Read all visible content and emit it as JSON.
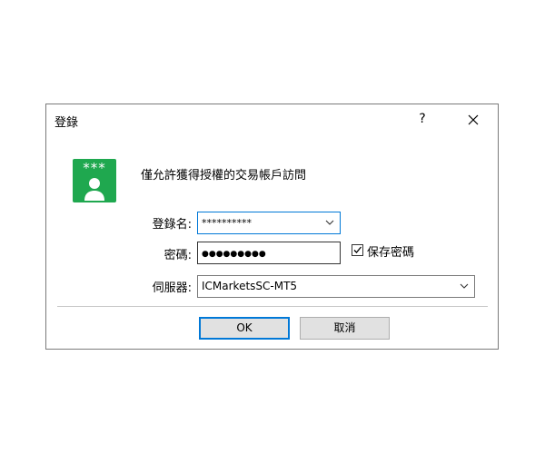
{
  "dialog": {
    "title": "登錄",
    "help_label": "?",
    "close_icon": "close-icon",
    "message": "僅允許獲得授權的交易帳戶訪問",
    "avatar_icon": "user-lock-icon",
    "avatar_stars": "***",
    "login": {
      "label": "登錄名:",
      "value": "**********"
    },
    "password": {
      "label": "密碼:",
      "value": "●●●●●●●●●"
    },
    "save_password": {
      "label": "保存密碼",
      "checked": true
    },
    "server": {
      "label": "伺服器:",
      "value": "ICMarketsSC-MT5"
    },
    "ok_label": "OK",
    "cancel_label": "取消"
  },
  "colors": {
    "accent": "#0078d7",
    "avatar_bg": "#1fa84f",
    "button_bg": "#e1e1e1"
  }
}
